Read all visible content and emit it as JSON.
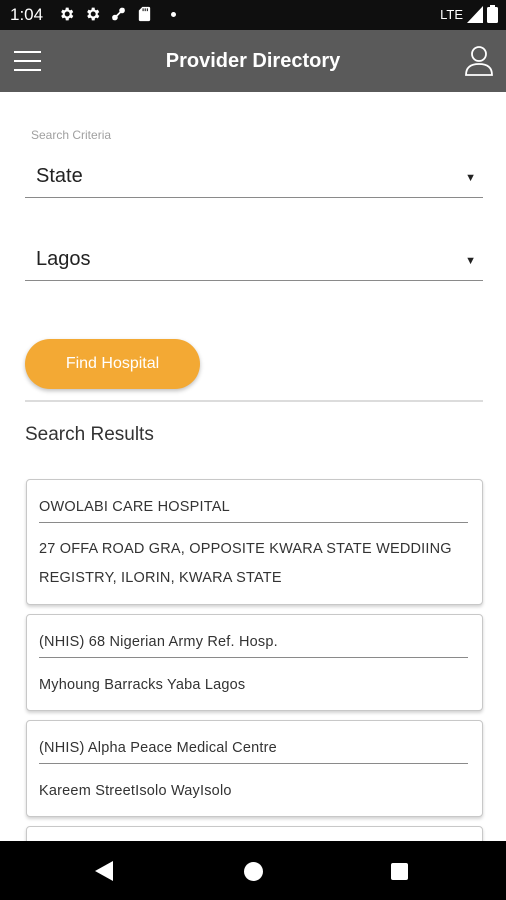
{
  "status_bar": {
    "time": "1:04",
    "network": "LTE",
    "icons": [
      "settings-icon",
      "settings-icon",
      "sync-off-icon",
      "sd-card-icon",
      "dot-icon",
      "signal-icon",
      "battery-icon"
    ]
  },
  "app_bar": {
    "title": "Provider Directory",
    "menu_icon": "hamburger-menu-icon",
    "profile_icon": "user-profile-icon"
  },
  "search": {
    "criteria_label": "Search Criteria",
    "criteria_value": "State",
    "location_value": "Lagos",
    "find_button": "Find Hospital"
  },
  "results": {
    "title": "Search Results",
    "items": [
      {
        "name": "OWOLABI CARE HOSPITAL",
        "address_line1": "27 OFFA ROAD GRA, OPPOSITE KWARA STATE WEDDIING",
        "address_line2": "REGISTRY, ILORIN, KWARA STATE"
      },
      {
        "name": "(NHIS) 68 Nigerian Army Ref. Hosp.",
        "address_line1": "Myhoung Barracks Yaba Lagos"
      },
      {
        "name": "(NHIS) Alpha Peace Medical Centre",
        "address_line1": "Kareem StreetIsolo WayIsolo"
      }
    ]
  },
  "colors": {
    "app_bar": "#5a5a5a",
    "accent": "#f3a934",
    "status_bar": "#0f0f0f",
    "nav_bar": "#000000"
  },
  "nav_bar": {
    "icons": [
      "back-triangle-icon",
      "home-circle-icon",
      "recents-square-icon"
    ]
  }
}
